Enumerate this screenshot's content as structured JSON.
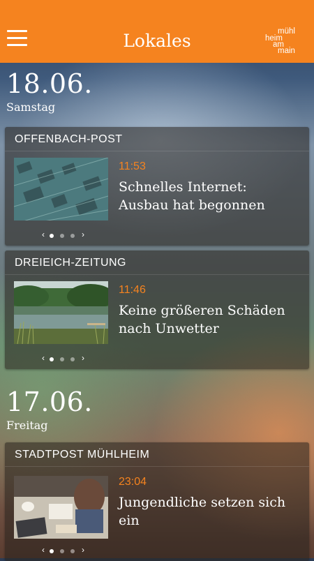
{
  "appbar": {
    "title": "Lokales",
    "menu_icon": "hamburger-menu-icon",
    "logo": {
      "line1": "mühl",
      "line2": "heim",
      "line3": "am",
      "line4": "main"
    },
    "color": "#f5831f"
  },
  "days": [
    {
      "date": "18.06.",
      "weekday": "Samstag",
      "cards": [
        {
          "source": "OFFENBACH-POST",
          "time": "11:53",
          "headline": "Schnelles Internet: Ausbau hat begonnen",
          "image": "circuit-board-photo",
          "pager": {
            "current": 1,
            "total": 3
          }
        },
        {
          "source": "DREIEICH-ZEITUNG",
          "time": "11:46",
          "headline": "Keine größeren Schäden nach Unwetter",
          "image": "lake-landscape-photo",
          "pager": {
            "current": 1,
            "total": 3
          }
        }
      ]
    },
    {
      "date": "17.06.",
      "weekday": "Freitag",
      "cards": [
        {
          "source": "STADTPOST MÜHLHEIM",
          "time": "23:04",
          "headline": "Jungendliche setzen sich ein",
          "image": "meeting-table-photo",
          "pager": {
            "current": 1,
            "total": 3
          }
        }
      ]
    }
  ]
}
